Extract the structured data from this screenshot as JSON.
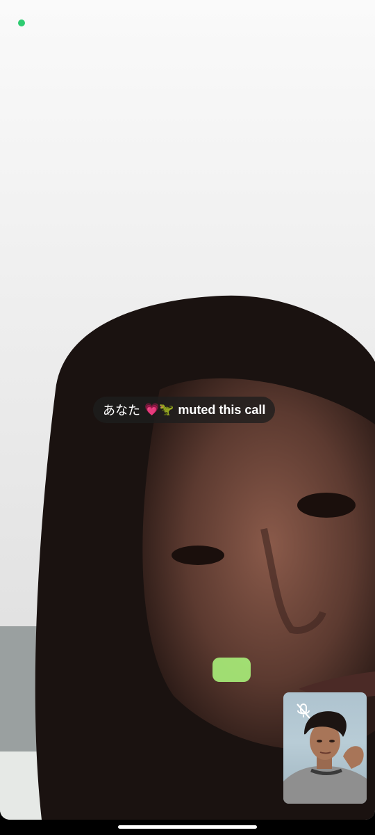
{
  "remote_video": {
    "description_icon": "remote-participant-video"
  },
  "status": {
    "camera_indicator_color": "#2ecc71"
  },
  "notice": {
    "name": "あなた",
    "emoji": "💗🦖",
    "text": "muted this call"
  },
  "self_view": {
    "mic_state_icon": "mic-off-icon"
  },
  "colors": {
    "pill_background": "#1e1e1e",
    "pill_text": "#ffffff"
  }
}
